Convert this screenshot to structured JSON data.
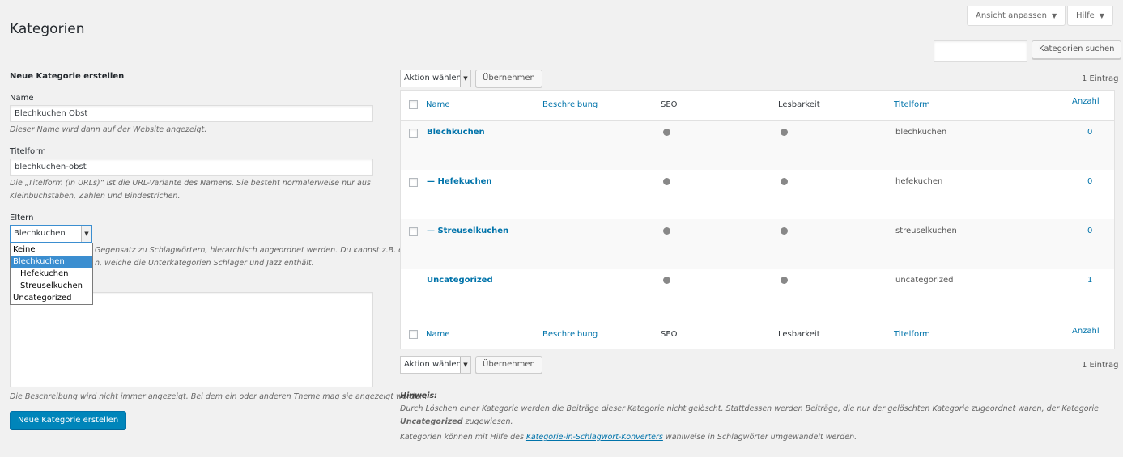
{
  "header": {
    "title": "Kategorien",
    "screen_options_label": "Ansicht anpassen",
    "help_label": "Hilfe",
    "search_value": "",
    "search_button": "Kategorien suchen"
  },
  "form": {
    "heading": "Neue Kategorie erstellen",
    "name_label": "Name",
    "name_value": "Blechkuchen Obst",
    "name_hint": "Dieser Name wird dann auf der Website angezeigt.",
    "slug_label": "Titelform",
    "slug_value": "blechkuchen-obst",
    "slug_hint_1": "Die „Titelform (in URLs)“ ist die URL-Variante des Namens. Sie besteht normalerweise nur aus",
    "slug_hint_2": "Kleinbuchstaben, Zahlen und Bindestrichen.",
    "parent_label": "Eltern",
    "parent_value": "Blechkuchen",
    "parent_options": [
      {
        "label": "Keine",
        "selected": false,
        "indent": false
      },
      {
        "label": "Blechkuchen",
        "selected": true,
        "indent": false
      },
      {
        "label": "Hefekuchen",
        "selected": false,
        "indent": true
      },
      {
        "label": "Streuselkuchen",
        "selected": false,
        "indent": true
      },
      {
        "label": "Uncategorized",
        "selected": false,
        "indent": false
      }
    ],
    "parent_hint_1": "Gegensatz zu Schlagwörtern, hierarchisch angeordnet werden. Du kannst z.B. eine",
    "parent_hint_2": "n, welche die Unterkategorien Schlager und Jazz enthält.",
    "description_value": "",
    "description_hint": "Die Beschreibung wird nicht immer angezeigt. Bei dem ein oder anderen Theme mag sie angezeigt werden.",
    "submit_label": "Neue Kategorie erstellen"
  },
  "bulk": {
    "action_label": "Aktion wählen",
    "apply_label": "Übernehmen",
    "count_label": "1 Eintrag"
  },
  "table": {
    "columns": {
      "name": "Name",
      "description": "Beschreibung",
      "seo": "SEO",
      "readability": "Lesbarkeit",
      "slug": "Titelform",
      "count": "Anzahl"
    },
    "rows": [
      {
        "name": "Blechkuchen",
        "slug": "blechkuchen",
        "count": "0",
        "checkbox": true
      },
      {
        "name": "— Hefekuchen",
        "slug": "hefekuchen",
        "count": "0",
        "checkbox": true
      },
      {
        "name": "— Streuselkuchen",
        "slug": "streuselkuchen",
        "count": "0",
        "checkbox": true
      },
      {
        "name": "Uncategorized",
        "slug": "uncategorized",
        "count": "1",
        "checkbox": false
      }
    ]
  },
  "notes": {
    "heading": "Hinweis:",
    "line1_a": "Durch Löschen einer Kategorie werden die Beiträge dieser Kategorie nicht gelöscht. Stattdessen werden Beiträge, die nur der gelöschten Kategorie zugeordnet waren, der Kategorie",
    "line1_b": "Uncategorized",
    "line1_c": "zugewiesen.",
    "line2_a": "Kategorien können mit Hilfe des",
    "line2_link": "Kategorie-in-Schlagwort-Konverters",
    "line2_b": "wahlweise in Schlagwörter umgewandelt werden."
  },
  "colors": {
    "link": "#0073aa",
    "primary_button": "#0085ba",
    "dropdown_selected": "#3b8ed0",
    "status_dot": "#888888"
  }
}
